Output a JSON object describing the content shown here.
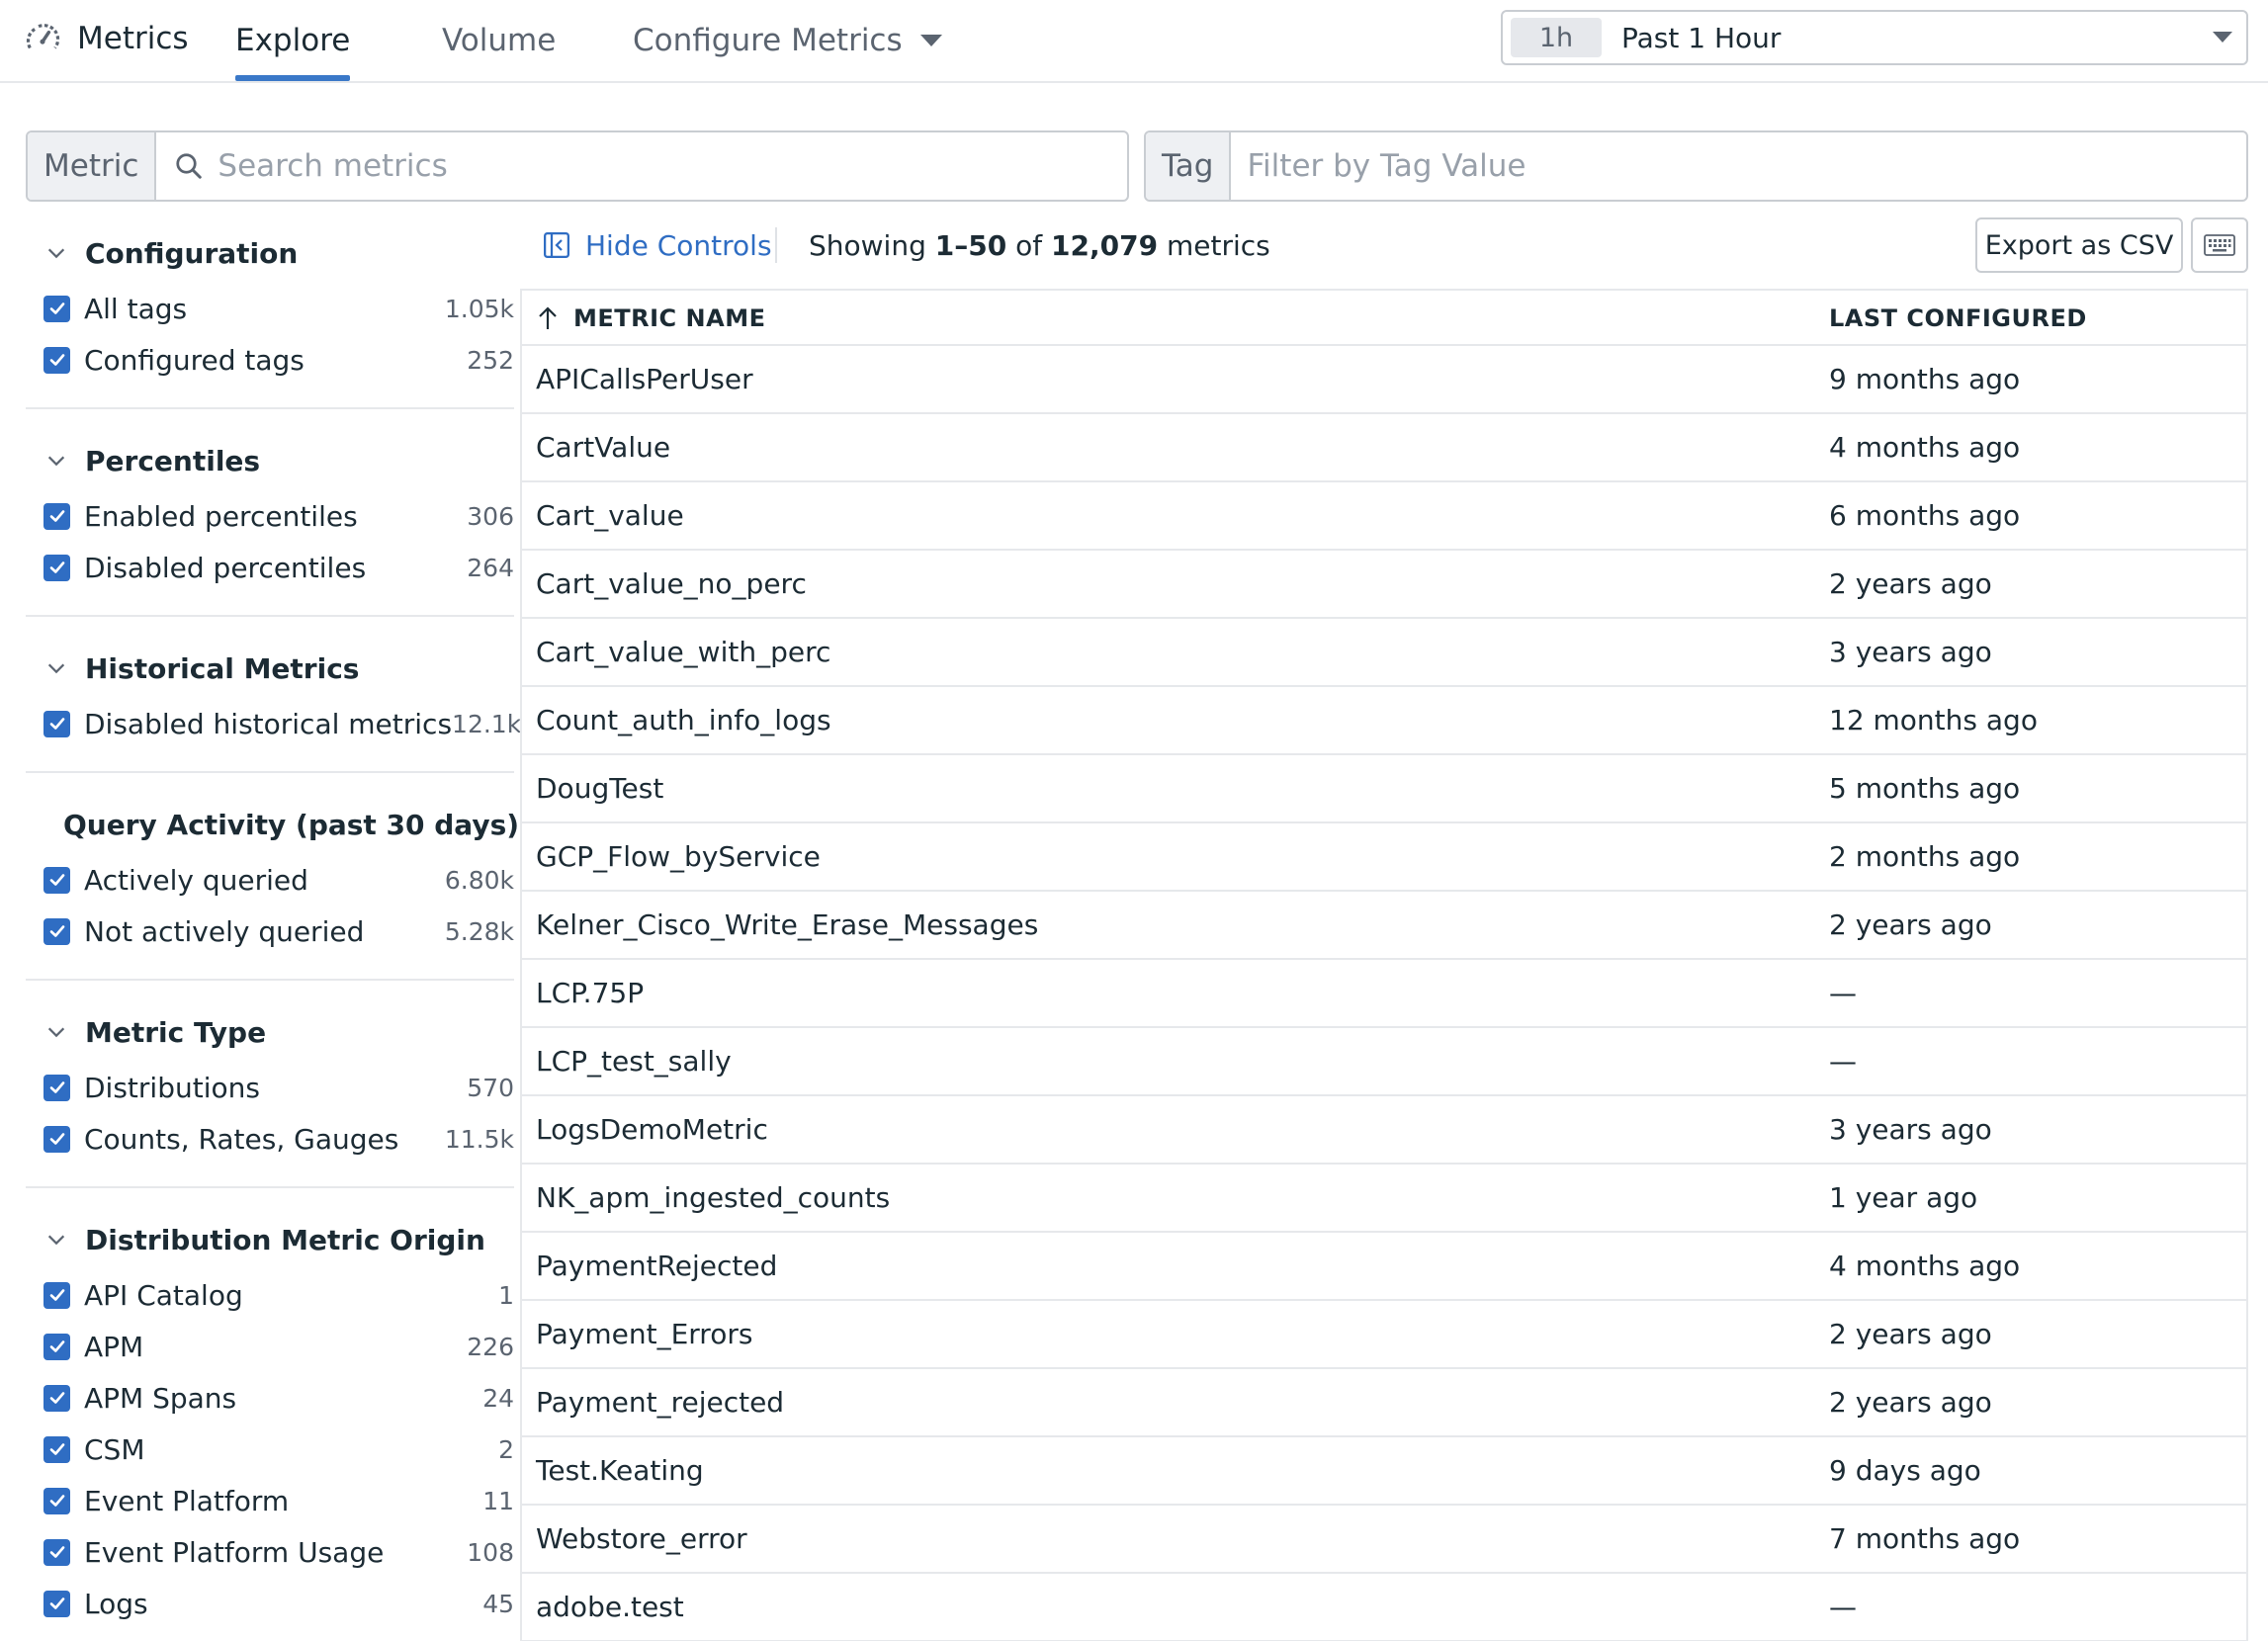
{
  "nav": {
    "brand": "Metrics",
    "tabs": [
      {
        "label": "Explore"
      },
      {
        "label": "Volume"
      },
      {
        "label": "Configure Metrics"
      }
    ],
    "time": {
      "badge": "1h",
      "label": "Past 1 Hour"
    }
  },
  "search": {
    "metric_prefix": "Metric",
    "metric_placeholder": "Search metrics",
    "tag_prefix": "Tag",
    "tag_placeholder": "Filter by Tag Value"
  },
  "sidebar": {
    "sections": [
      {
        "title": "Configuration",
        "options": [
          {
            "label": "All tags",
            "count": "1.05k"
          },
          {
            "label": "Configured tags",
            "count": "252"
          }
        ]
      },
      {
        "title": "Percentiles",
        "options": [
          {
            "label": "Enabled percentiles",
            "count": "306"
          },
          {
            "label": "Disabled percentiles",
            "count": "264"
          }
        ]
      },
      {
        "title": "Historical Metrics",
        "options": [
          {
            "label": "Disabled historical metrics",
            "count": "12.1k"
          }
        ]
      },
      {
        "title": "Query Activity (past 30 days)",
        "options": [
          {
            "label": "Actively queried",
            "count": "6.80k"
          },
          {
            "label": "Not actively queried",
            "count": "5.28k"
          }
        ]
      },
      {
        "title": "Metric Type",
        "options": [
          {
            "label": "Distributions",
            "count": "570"
          },
          {
            "label": "Counts, Rates, Gauges",
            "count": "11.5k"
          }
        ]
      },
      {
        "title": "Distribution Metric Origin",
        "options": [
          {
            "label": "API Catalog",
            "count": "1"
          },
          {
            "label": "APM",
            "count": "226"
          },
          {
            "label": "APM Spans",
            "count": "24"
          },
          {
            "label": "CSM",
            "count": "2"
          },
          {
            "label": "Event Platform",
            "count": "11"
          },
          {
            "label": "Event Platform Usage",
            "count": "108"
          },
          {
            "label": "Logs",
            "count": "45"
          }
        ]
      }
    ]
  },
  "toolbar": {
    "hide_controls": "Hide Controls",
    "showing_prefix": "Showing",
    "showing_range": "1–50",
    "showing_of": "of",
    "showing_total": "12,079",
    "showing_suffix": "metrics",
    "export": "Export as CSV"
  },
  "table": {
    "headers": {
      "name": "METRIC NAME",
      "last": "LAST CONFIGURED"
    },
    "rows": [
      {
        "name": "APICallsPerUser",
        "last": "9 months ago"
      },
      {
        "name": "CartValue",
        "last": "4 months ago"
      },
      {
        "name": "Cart_value",
        "last": "6 months ago"
      },
      {
        "name": "Cart_value_no_perc",
        "last": "2 years ago"
      },
      {
        "name": "Cart_value_with_perc",
        "last": "3 years ago"
      },
      {
        "name": "Count_auth_info_logs",
        "last": "12 months ago"
      },
      {
        "name": "DougTest",
        "last": "5 months ago"
      },
      {
        "name": "GCP_Flow_byService",
        "last": "2 months ago"
      },
      {
        "name": "Kelner_Cisco_Write_Erase_Messages",
        "last": "2 years ago"
      },
      {
        "name": "LCP.75P",
        "last": "—"
      },
      {
        "name": "LCP_test_sally",
        "last": "—"
      },
      {
        "name": "LogsDemoMetric",
        "last": "3 years ago"
      },
      {
        "name": "NK_apm_ingested_counts",
        "last": "1 year ago"
      },
      {
        "name": "PaymentRejected",
        "last": "4 months ago"
      },
      {
        "name": "Payment_Errors",
        "last": "2 years ago"
      },
      {
        "name": "Payment_rejected",
        "last": "2 years ago"
      },
      {
        "name": "Test.Keating",
        "last": "9 days ago"
      },
      {
        "name": "Webstore_error",
        "last": "7 months ago"
      },
      {
        "name": "adobe.test",
        "last": "—"
      }
    ]
  }
}
